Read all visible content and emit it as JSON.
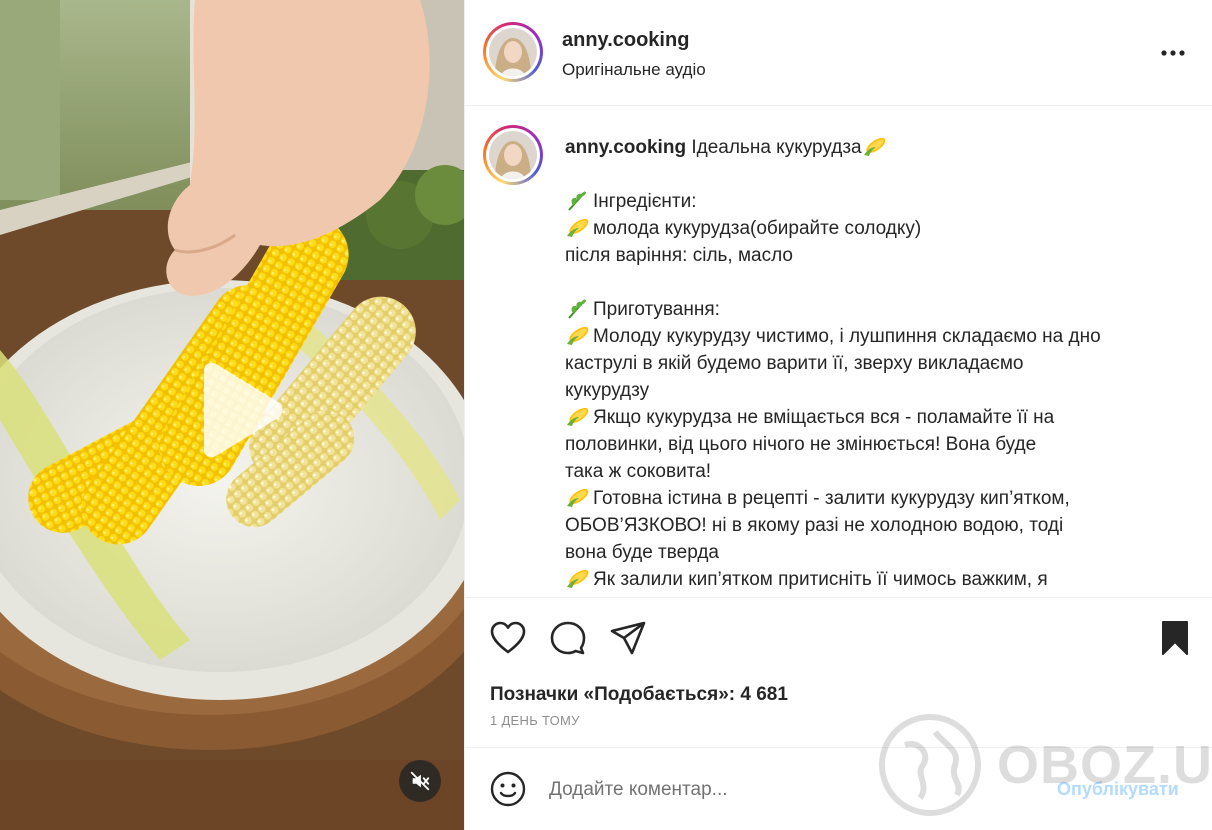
{
  "header": {
    "username": "anny.cooking",
    "audio_label": "Оригінальне аудіо",
    "more_icon": "more-horizontal-icon"
  },
  "caption": {
    "username": "anny.cooking",
    "lines": [
      "Ідеальна кукурудза",
      "",
      "Інгредієнти:",
      "молода кукурудза(обирайте солодку)",
      "після варіння: сіль, масло",
      "",
      "Приготування:",
      "Молоду кукурудзу чистимо, і лушпиння складаємо на дно",
      "каструлі в якій будемо варити її, зверху викладаємо",
      "кукурудзу",
      "Якщо кукурудза не вміщається вся - поламайте її на",
      "половинки, від цього нічого не змінюється! Вона буде",
      "така ж соковита!",
      "Готовна істина в рецепті - залити кукурудзу кип’ятком,",
      "ОБОВ’ЯЗКОВО! ні в якому разі не холодною водою, тоді",
      "вона буде тверда",
      "Як залили кип’ятком притисніть її чимось важким, я"
    ]
  },
  "actions": {
    "like_icon": "heart-icon",
    "comment_icon": "comment-icon",
    "share_icon": "send-icon",
    "save_icon": "bookmark-icon"
  },
  "likes_text": "Позначки «Подобається»: 4 681",
  "time_text": "1 ДЕНЬ ТОМУ",
  "comment": {
    "placeholder": "Додайте коментар...",
    "publish_label": "Опублікувати"
  },
  "watermark": "OBOZ.UA",
  "colors": {
    "text": "#262626",
    "secondary": "#8e8e8e",
    "publish_disabled": "#b3dbff",
    "border": "#efefef"
  }
}
